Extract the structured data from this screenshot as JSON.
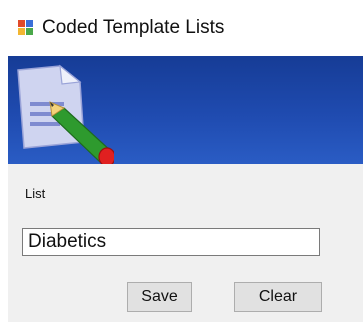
{
  "window": {
    "title": "Coded Template Lists",
    "app_icon": "template-app-icon"
  },
  "banner": {
    "icon": "document-edit-icon"
  },
  "form": {
    "list_label": "List",
    "list_value": "Diabetics"
  },
  "buttons": {
    "save_label": "Save",
    "clear_label": "Clear"
  },
  "colors": {
    "banner": "#1f4bb0",
    "form_background": "#f0f0f0",
    "button_face": "#e1e1e1",
    "pencil_green": "#2e9a2e",
    "eraser_red": "#e02020"
  }
}
